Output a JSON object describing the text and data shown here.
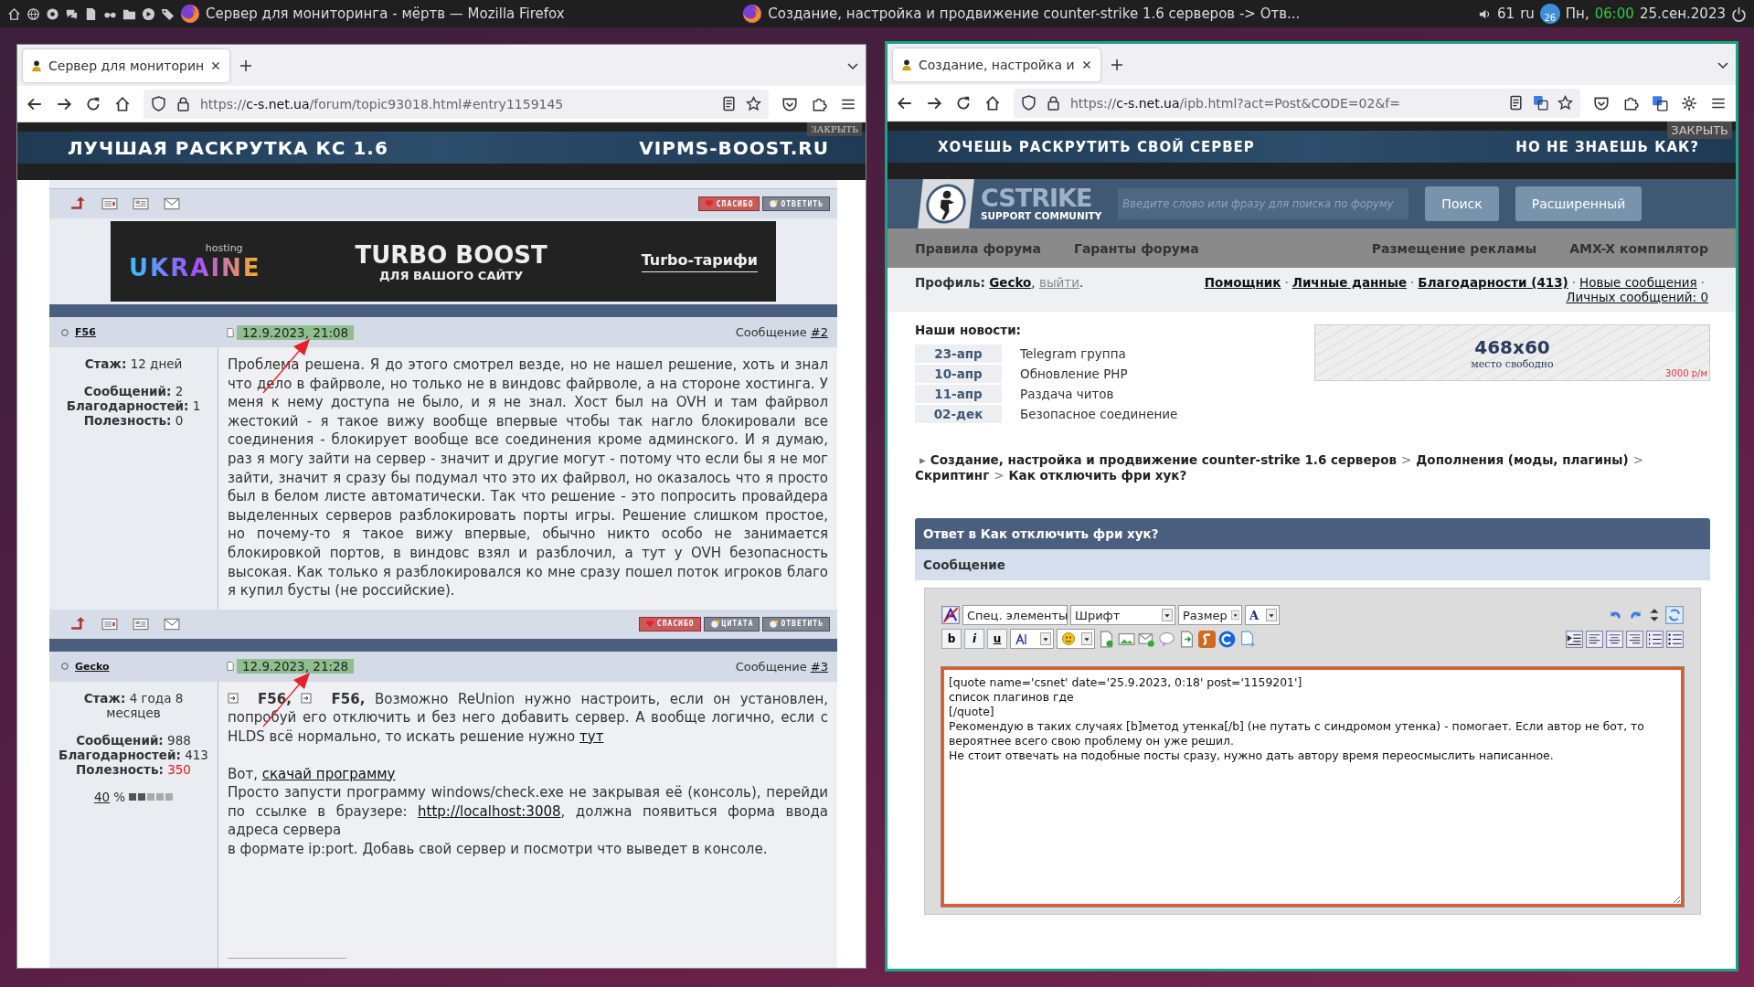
{
  "taskbar": {
    "windows": [
      "Сервер для мониторинга - мёртв — Mozilla Firefox",
      "Создание, настройка и продвижение counter-strike 1.6 серверов -> Отв..."
    ],
    "volume": "61",
    "keyboard_layout": "ru",
    "notification_badge": "26",
    "day": "Пн,",
    "time": "06:00",
    "date": "25.сен.2023"
  },
  "left_browser": {
    "active": false,
    "tab": "Сервер для мониторин",
    "url": {
      "scheme": "https://",
      "host": "c-s.net.ua",
      "path": "/forum/topic93018.html#entry1159145"
    },
    "banner": {
      "headline": "ЛУЧШАЯ РАСКРУТКА КС 1.6",
      "tagline": "VIPMS-BOOST.RU",
      "close": "ЗАКРЫТЬ"
    },
    "top_actions": [
      "СПАСИБО",
      "ОТВЕТИТЬ"
    ],
    "ad": {
      "brand_small": "hosting",
      "brand": "UKRAINE",
      "headline": "TURBO BOOST",
      "subline": "ДЛЯ ВАШОГО САЙТУ",
      "link": "Turbo-тарифи"
    },
    "posts": [
      {
        "author": "F56",
        "date": "12.9.2023, 21:08",
        "date_marked": true,
        "annotation_arrow": true,
        "label": "Сообщение",
        "number": "#2",
        "stats": [
          {
            "label": "Стаж:",
            "value": "12 дней",
            "highlighted": false
          },
          {
            "label": "Сообщений:",
            "value": "2",
            "highlighted": false
          },
          {
            "label": "Благодарностей:",
            "value": "1",
            "highlighted": false
          },
          {
            "label": "Полезность:",
            "value": "0",
            "highlighted": false
          }
        ],
        "paragraphs": [
          [
            {
              "kind": "text",
              "text": "Проблема решена. Я до этого смотрел везде, но не нашел решение, хоть и знал что дело в файрволе, но только не в виндовс файрволе, а на стороне хостинга. У меня к нему доступа не было, и я не знал. Хост был на OVH и там файрвол жестокий - я такое вижу вообще впервые чтобы так нагло блокировали все соединения - блокирует вообще все соединения кроме админского. И я думаю, раз я могу зайти на сервер - значит и другие могут - потому что если бы я не мог зайти, значит я сразу бы подумал что это их файрвол, но оказалось что я просто был в белом листе автоматически. Так что решение - это попросить провайдера выделенных серверов разблокировать порты игры. Решение слишком простое, но почему-то я такое вижу впервые, обычно никто особо не занимается блокировкой портов, в виндовс взял и разблочил, а тут у OVH безопасность высокая. Как только я разблокировался ко мне сразу пошел поток игроков благо я купил бусты (не российские)."
            }
          ]
        ],
        "actions": [
          "СПАСИБО",
          "ЦИТАТА",
          "ОТВЕТИТЬ"
        ]
      },
      {
        "author": "Gecko",
        "date": "12.9.2023, 21:28",
        "date_marked": true,
        "annotation_arrow": true,
        "label": "Сообщение",
        "number": "#3",
        "stats": [
          {
            "label": "Стаж:",
            "value": "4 года 8 месяцев",
            "highlighted": false
          },
          {
            "label": "Сообщений:",
            "value": "988",
            "highlighted": false
          },
          {
            "label": "Благодарностей:",
            "value": "413",
            "highlighted": false
          },
          {
            "label": "Полезность:",
            "value": "350",
            "highlighted": true
          }
        ],
        "reputation": {
          "percent": "40",
          "sign": "%",
          "level": 0.4
        },
        "paragraphs": [
          [
            {
              "kind": "mention",
              "text": "F56,"
            },
            {
              "kind": "mention",
              "text": "F56,"
            },
            {
              "kind": "text",
              "text": "Возможно ReUnion нужно настроить, если он установлен, попробуй его отключить и без него добавить сервер. А вообще логично, если с HLDS всё нормально, то искать решение нужно "
            },
            {
              "kind": "link",
              "text": "тут"
            }
          ],
          [
            {
              "kind": "text",
              "text": "Вот, "
            },
            {
              "kind": "link",
              "text": "скачай программу"
            }
          ],
          [
            {
              "kind": "text",
              "text": "Просто запусти программу windows/check.exe не закрывая её (консоль), перейди по ссылке в браузере: "
            },
            {
              "kind": "link",
              "text": "http://localhost:3008"
            },
            {
              "kind": "text",
              "text": ", должна появиться форма ввода адреса сервера"
            }
          ],
          [
            {
              "kind": "text",
              "text": "в формате ip:port. Добавь свой сервер и посмотри что выведет в консоле."
            }
          ]
        ]
      }
    ]
  },
  "right_browser": {
    "active": true,
    "tab": "Создание, настройка и",
    "url": {
      "scheme": "https://",
      "host": "c-s.net.ua",
      "path": "/ipb.html?act=Post&CODE=02&f="
    },
    "banner": {
      "headline": "ХОЧЕШЬ РАСКРУТИТЬ СВОЙ СЕРВЕР",
      "tagline": "НО НЕ ЗНАЕШЬ КАК?",
      "close": "ЗАКРЫТЬ"
    },
    "header": {
      "logo_title": "CSTRIKE",
      "logo_subtitle": "SUPPORT COMMUNITY",
      "search_placeholder": "Введите слово или фразу для поиска по форуму",
      "buttons": [
        "Поиск",
        "Расширенный"
      ]
    },
    "nav_left": [
      "Правила форума",
      "Гаранты форума"
    ],
    "nav_right": [
      "Размещение рекламы",
      "AMX-X компилятор"
    ],
    "profile": {
      "label": "Профиль:",
      "user": "Gecko",
      "comma": ",",
      "logout": "выйти",
      "period": ".",
      "links": [
        {
          "text": "Помощник",
          "kind": "strong"
        },
        {
          "separator": "·",
          "text": "Личные данные",
          "kind": "strong"
        },
        {
          "separator": "·",
          "text": "Благодарности (413)",
          "kind": "strong"
        },
        {
          "separator": "·",
          "text": "Новые сообщения",
          "kind": "plain"
        },
        {
          "separator": "·",
          "text": "Личных сообщений: 0",
          "kind": "plain"
        }
      ]
    },
    "news": {
      "title": "Наши новости:",
      "items": [
        {
          "date": "23-апр",
          "text": "Telegram группа"
        },
        {
          "date": "10-апр",
          "text": "Обновление PHP"
        },
        {
          "date": "11-апр",
          "text": "Раздача читов"
        },
        {
          "date": "02-дек",
          "text": "Безопасное соединение"
        }
      ]
    },
    "ad_slot": {
      "size": "468x60",
      "caption": "место свободно",
      "price": "3000 р/м"
    },
    "breadcrumb": [
      {
        "separator": "▸",
        "text": "Создание, настройка и продвижение counter-strike 1.6 серверов"
      },
      {
        "separator": ">",
        "text": "Дополнения (моды, плагины)"
      },
      {
        "separator": ">",
        "text": "Скриптинг"
      },
      {
        "separator": ">",
        "text": "Как отключить фри хук?"
      }
    ],
    "reply_form": {
      "title": "Ответ в Как отключить фри хук?",
      "section": "Сообщение",
      "selects": [
        "Спец. элементы",
        "Шрифт",
        "Размер"
      ],
      "color_select": "A",
      "format_buttons": [
        "b",
        "i",
        "u"
      ],
      "text": "[quote name='csnet' date='25.9.2023, 0:18' post='1159201']\nсписок плагинов где\n[/quote]\nРекомендую в таких случаях [b]метод утенка[/b] (не путать с синдромом утенка) - помогает. Если автор не бот, то вероятнее всего свою проблему он уже решил.\nНе стоит отвечать на подобные посты сразу, нужно дать автору время переосмыслить написанное."
    }
  }
}
